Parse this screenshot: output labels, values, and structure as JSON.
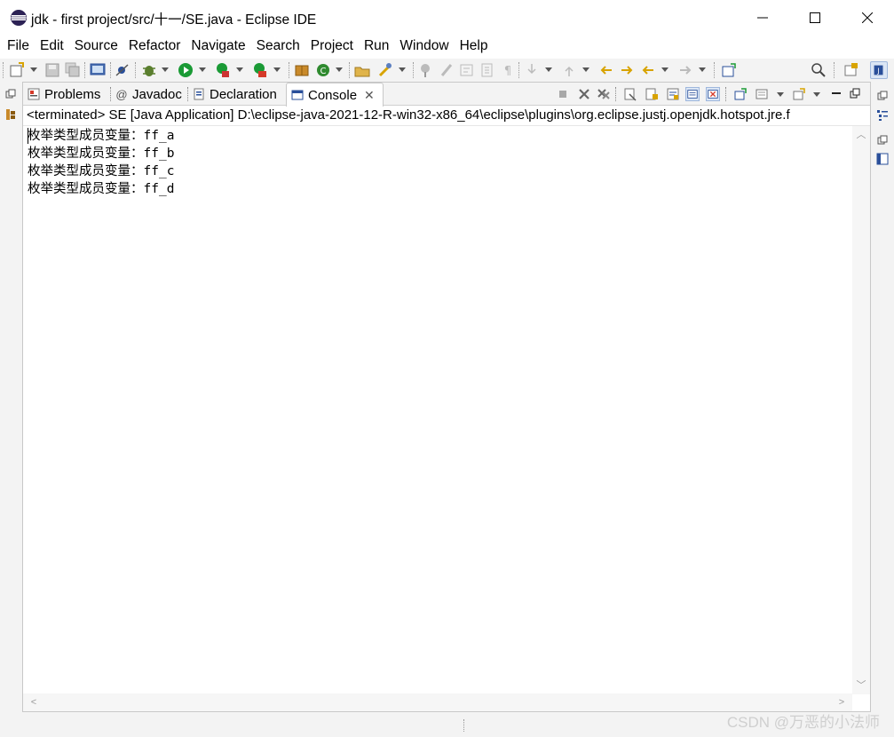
{
  "window": {
    "title": "jdk - first project/src/十一/SE.java - Eclipse IDE"
  },
  "menu": [
    "File",
    "Edit",
    "Source",
    "Refactor",
    "Navigate",
    "Search",
    "Project",
    "Run",
    "Window",
    "Help"
  ],
  "tabs": [
    {
      "label": "Problems",
      "icon": "problems-icon"
    },
    {
      "label": "Javadoc",
      "icon": "javadoc-icon"
    },
    {
      "label": "Declaration",
      "icon": "declaration-icon"
    },
    {
      "label": "Console",
      "icon": "console-icon",
      "active": true
    }
  ],
  "console": {
    "status": "<terminated> SE [Java Application] D:\\eclipse-java-2021-12-R-win32-x86_64\\eclipse\\plugins\\org.eclipse.justj.openjdk.hotspot.jre.f",
    "lines": [
      "枚举类型成员变量：ff_a",
      "枚举类型成员变量：ff_b",
      "枚举类型成员变量：ff_c",
      "枚举类型成员变量：ff_d"
    ]
  },
  "watermark": "CSDN @万恶的小法师",
  "colors": {
    "accent": "#2a4f9a",
    "run_green": "#1a9a35",
    "debug_red": "#d53a2a",
    "chrome": "#f3f3f3"
  }
}
